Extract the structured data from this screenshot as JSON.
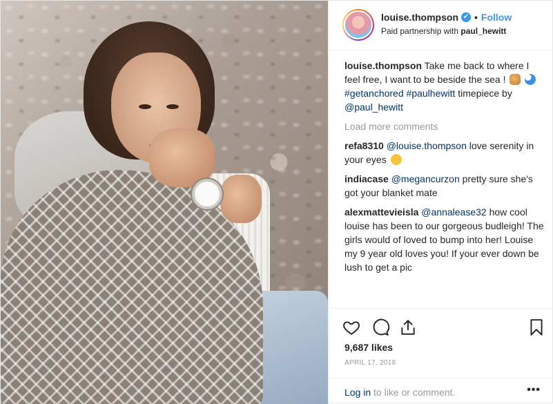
{
  "post": {
    "username": "louise.thompson",
    "verified_glyph": "✔",
    "dot": "•",
    "follow_label": "Follow",
    "partnership_prefix": "Paid partnership with",
    "partner": "paul_hewitt"
  },
  "caption": {
    "user": "louise.thompson",
    "text": "Take me back to where I feel free, I want to be beside the sea !",
    "hashtag1": "#getanchored",
    "hashtag2": "#paulhewitt",
    "text2": "timepiece by",
    "mention": "@paul_hewitt"
  },
  "load_more": "Load more comments",
  "comments": [
    {
      "user": "refa8310",
      "mention": "@louise.thompson",
      "text": "love serenity in your eyes"
    },
    {
      "user": "indiacase",
      "mention": "@megancurzon",
      "text": "pretty sure she's got your blanket mate"
    },
    {
      "user": "alexmattevieisla",
      "mention": "@annalease32",
      "text": "how cool louise has been to our gorgeous budleigh! The girls would of loved to bump into her! Louise my 9 year old loves you! If your ever down be lush to get a pic"
    }
  ],
  "stats": {
    "likes": "9,687 likes",
    "date": "APRIL 17, 2018"
  },
  "footer": {
    "login_label": "Log in",
    "login_suffix": "to like or comment.",
    "more": "•••"
  },
  "icons": {
    "like": "heart-icon",
    "comment": "comment-icon",
    "share": "share-icon",
    "save": "bookmark-icon"
  },
  "colors": {
    "accent": "#3897f0",
    "link": "#003569",
    "muted": "#999999"
  }
}
